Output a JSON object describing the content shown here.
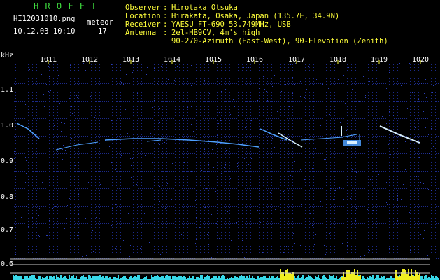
{
  "header": {
    "app_title": "H R O F F T",
    "filename": "HI12031010.png",
    "datetime": "10.12.03 10:10",
    "meteor_label": "meteor",
    "meteor_count": "17"
  },
  "info": {
    "observer_label": "Observer",
    "observer_value": "Hirotaka Otsuka",
    "location_label": "Location",
    "location_value": "Hirakata, Osaka, Japan (135.7E, 34.9N)",
    "receiver_label": "Receiver",
    "receiver_value": "YAESU FT-690 53.749MHz, USB",
    "antenna_label": "Antenna",
    "antenna_value": "2el-HB9CV, 4m's high",
    "antenna_value2": "90-270-Azimuth (East-West), 90-Elevation (Zenith)"
  },
  "axis": {
    "unit": "kHz",
    "x_ticks": [
      "1011",
      "1012",
      "1013",
      "1014",
      "1015",
      "1016",
      "1017",
      "1018",
      "1019",
      "1020"
    ],
    "y_ticks": [
      "1.1",
      "1.0",
      "0.9",
      "0.8",
      "0.7",
      "0.6"
    ]
  },
  "colors": {
    "background": "#000000",
    "grid_dots": "#1c2a8a",
    "echo": "#4ea0ff",
    "echo_bright": "#d8f0ff",
    "noise_cyan": "#38d8e8",
    "noise_yellow": "#f0ee20",
    "ruler": "#c8c8c8",
    "tick_yellow": "#ffff3a"
  }
}
